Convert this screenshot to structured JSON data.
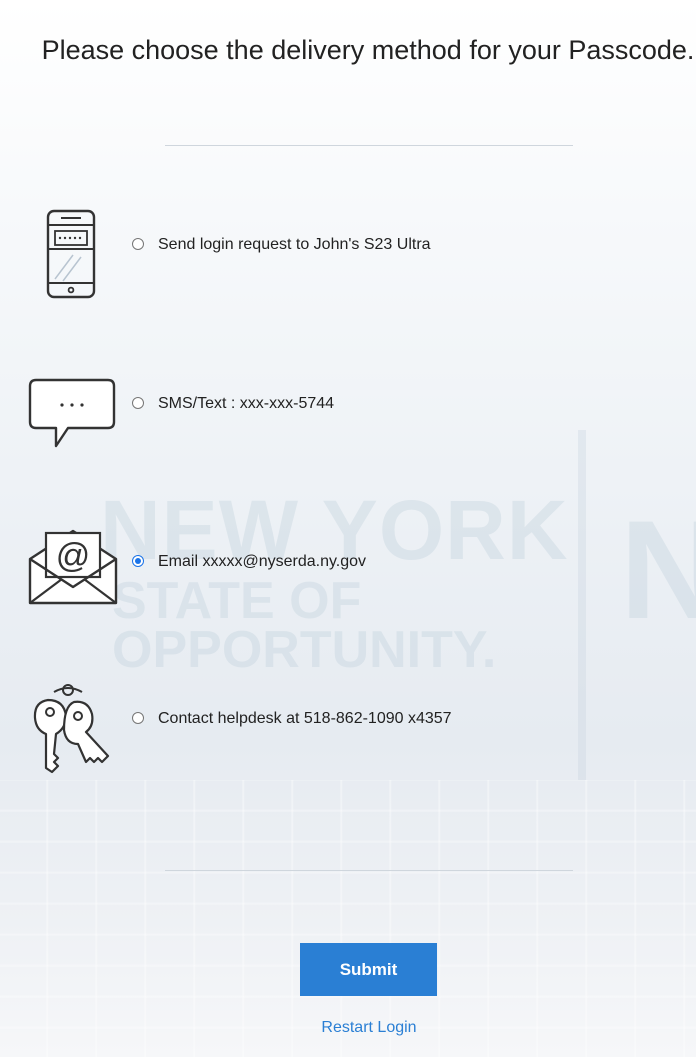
{
  "page": {
    "title": "Please choose the delivery method for your Passcode."
  },
  "options": [
    {
      "id": "push",
      "label": "Send login request to John's S23 Ultra",
      "icon": "smartphone-icon",
      "selected": false
    },
    {
      "id": "sms",
      "label": "SMS/Text : xxx-xxx-5744",
      "icon": "chat-bubble-icon",
      "selected": false
    },
    {
      "id": "email",
      "label": "Email xxxxx@nyserda.ny.gov",
      "icon": "email-envelope-icon",
      "selected": true
    },
    {
      "id": "helpdesk",
      "label": "Contact helpdesk at 518-862-1090 x4357",
      "icon": "keys-icon",
      "selected": false
    }
  ],
  "actions": {
    "submit_label": "Submit",
    "restart_label": "Restart Login"
  },
  "background": {
    "watermark_line1": "NEW YORK",
    "watermark_line2": "STATE OF",
    "watermark_line3": "OPPORTUNITY.",
    "watermark_partial": "N"
  },
  "colors": {
    "accent": "#2a7fd4",
    "radio_selected": "#1a73e8",
    "text": "#222222",
    "divider": "#cfd6dd"
  }
}
